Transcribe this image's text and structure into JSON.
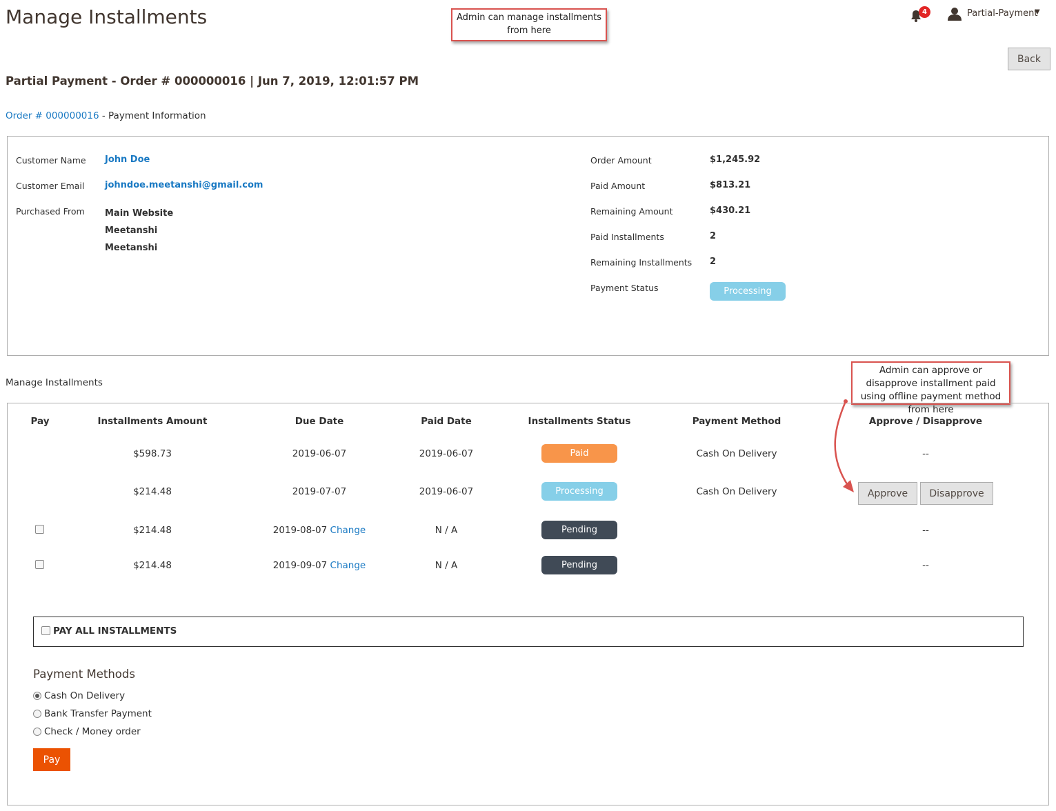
{
  "page": {
    "title": "Manage Installments"
  },
  "callouts": {
    "top": "Admin can manage installments from here",
    "side": "Admin can approve or disapprove installment paid using offline payment method from here"
  },
  "header": {
    "notification_count": "4",
    "user_name": "Partial-Payment",
    "back_label": "Back"
  },
  "order": {
    "heading": "Partial Payment - Order # 000000016 | Jun 7, 2019, 12:01:57 PM",
    "link_text": "Order # 000000016",
    "link_suffix": " - Payment Information"
  },
  "info": {
    "customer_name_label": "Customer Name",
    "customer_name": "John Doe",
    "customer_email_label": "Customer Email",
    "customer_email": "johndoe.meetanshi@gmail.com",
    "purchased_from_label": "Purchased From",
    "purchased_from": [
      "Main Website",
      "Meetanshi",
      "Meetanshi"
    ],
    "order_amount_label": "Order Amount",
    "order_amount": "$1,245.92",
    "paid_amount_label": "Paid Amount",
    "paid_amount": "$813.21",
    "remaining_amount_label": "Remaining Amount",
    "remaining_amount": "$430.21",
    "paid_installments_label": "Paid Installments",
    "paid_installments": "2",
    "remaining_installments_label": "Remaining Installments",
    "remaining_installments": "2",
    "payment_status_label": "Payment Status",
    "payment_status": "Processing"
  },
  "installments": {
    "section_title": "Manage Installments",
    "columns": [
      "Pay",
      "Installments Amount",
      "Due Date",
      "Paid Date",
      "Installments Status",
      "Payment Method",
      "Approve / Disapprove"
    ],
    "rows": [
      {
        "amount": "$598.73",
        "due": "2019-06-07",
        "change": "",
        "paid": "2019-06-07",
        "status": "Paid",
        "method": "Cash On Delivery",
        "approve": "--"
      },
      {
        "amount": "$214.48",
        "due": "2019-07-07",
        "change": "",
        "paid": "2019-06-07",
        "status": "Processing",
        "method": "Cash On Delivery",
        "approve": ""
      },
      {
        "amount": "$214.48",
        "due": "2019-08-07",
        "change": "Change",
        "paid": "N / A",
        "status": "Pending",
        "method": "",
        "approve": "--"
      },
      {
        "amount": "$214.48",
        "due": "2019-09-07",
        "change": "Change",
        "paid": "N / A",
        "status": "Pending",
        "method": "",
        "approve": "--"
      }
    ],
    "approve_label": "Approve",
    "disapprove_label": "Disapprove",
    "pay_all_label": "PAY ALL INSTALLMENTS"
  },
  "payment_methods": {
    "title": "Payment Methods",
    "options": [
      "Cash On Delivery",
      "Bank Transfer Payment",
      "Check / Money order"
    ],
    "selected": "Cash On Delivery",
    "pay_label": "Pay"
  },
  "colors": {
    "link": "#1979c3",
    "paid": "#f8954a",
    "processing": "#86cfe8",
    "pending": "#404a56",
    "primary_button": "#eb5202",
    "callout_border": "#d9534f"
  }
}
